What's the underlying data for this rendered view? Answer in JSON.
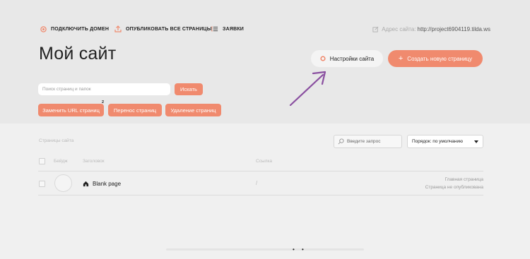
{
  "header": {
    "links": [
      {
        "label": "ПОДКЛЮЧИТЬ ДОМЕН",
        "icon": "globe-icon"
      },
      {
        "label": "ОПУБЛИКОВАТЬ ВСЕ СТРАНИЦЫ",
        "icon": "upload-icon"
      },
      {
        "label": "ЗАЯВКИ",
        "icon": "list-icon"
      }
    ],
    "address_label": "Адрес сайта:",
    "address_value": "http://project6904119.tilda.ws"
  },
  "page_title": "Мой сайт",
  "buttons": {
    "settings": "Настройки сайта",
    "create": "Создать новую страницу"
  },
  "search": {
    "placeholder": "Поиск страниц и папок",
    "button": "Искать"
  },
  "actions": {
    "replace_url": "Заменить URL страниц",
    "replace_url_count": "2",
    "move": "Перенос страниц",
    "delete": "Удаление страниц"
  },
  "list": {
    "section_label": "Страницы сайта",
    "filter_placeholder": "Введите запрос",
    "order_label": "Порядок: по умолчанию",
    "columns": {
      "badge": "Бейдж",
      "title": "Заголовок",
      "link": "Ссылка"
    },
    "rows": [
      {
        "name": "Blank page",
        "link": "/",
        "status_1": "Главная страница",
        "status_2": "Страница не опубликована"
      }
    ]
  },
  "colors": {
    "accent": "#f08a6e",
    "arrow": "#8a4fa0",
    "header_bg": "#e8e8e8",
    "body_bg": "#f0f0f0"
  }
}
